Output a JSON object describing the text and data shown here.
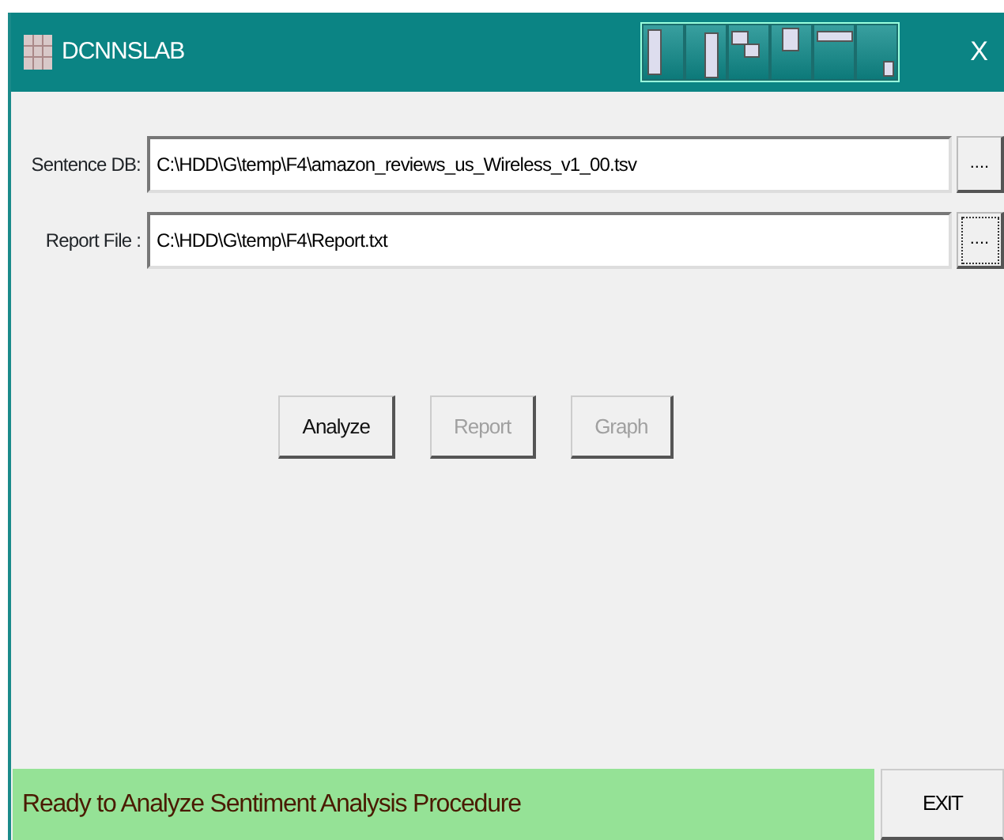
{
  "window": {
    "title": "DCNNSLAB",
    "close": "X"
  },
  "fields": [
    {
      "label": "Sentence DB:",
      "value": "C:\\HDD\\G\\temp\\F4\\amazon_reviews_us_Wireless_v1_00.tsv",
      "browse": "....",
      "focused": false
    },
    {
      "label": "Report File :",
      "value": "C:\\HDD\\G\\temp\\F4\\Report.txt",
      "browse": "....",
      "focused": true
    }
  ],
  "buttons": [
    {
      "label": "Analyze",
      "disabled": false
    },
    {
      "label": "Report",
      "disabled": true
    },
    {
      "label": "Graph",
      "disabled": true
    }
  ],
  "status_bar": {
    "text": "Ready to Analyze Sentiment Analysis Procedure",
    "exit": "EXIT"
  }
}
